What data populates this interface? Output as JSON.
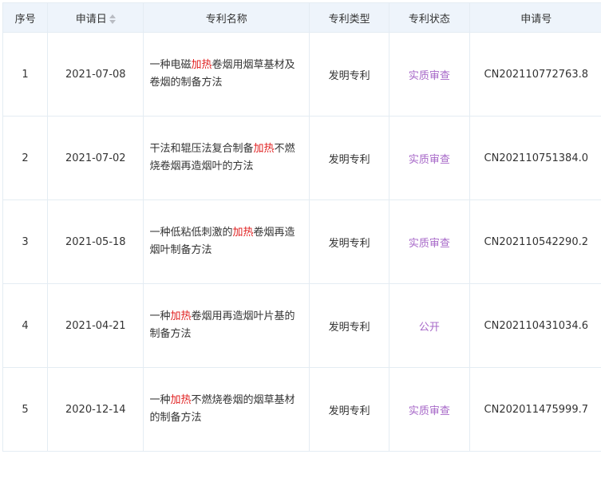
{
  "header": {
    "index": "序号",
    "date": "申请日",
    "name": "专利名称",
    "type": "专利类型",
    "status": "专利状态",
    "app_no": "申请号",
    "sort_icon": "sort-icon"
  },
  "rows": [
    {
      "index": "1",
      "date": "2021-07-08",
      "name_before": "一种电磁",
      "name_hl": "加热",
      "name_after": "卷烟用烟草基材及卷烟的制备方法",
      "type": "发明专利",
      "status": "实质审查",
      "app_no": "CN202110772763.8"
    },
    {
      "index": "2",
      "date": "2021-07-02",
      "name_before": "干法和辊压法复合制备",
      "name_hl": "加热",
      "name_after": "不燃烧卷烟再造烟叶的方法",
      "type": "发明专利",
      "status": "实质审查",
      "app_no": "CN202110751384.0"
    },
    {
      "index": "3",
      "date": "2021-05-18",
      "name_before": "一种低粘低刺激的",
      "name_hl": "加热",
      "name_after": "卷烟再造烟叶制备方法",
      "type": "发明专利",
      "status": "实质审查",
      "app_no": "CN202110542290.2"
    },
    {
      "index": "4",
      "date": "2021-04-21",
      "name_before": "一种",
      "name_hl": "加热",
      "name_after": "卷烟用再造烟叶片基的制备方法",
      "type": "发明专利",
      "status": "公开",
      "app_no": "CN202110431034.6"
    },
    {
      "index": "5",
      "date": "2020-12-14",
      "name_before": "一种",
      "name_hl": "加热",
      "name_after": "不燃烧卷烟的烟草基材的制备方法",
      "type": "发明专利",
      "status": "实质审查",
      "app_no": "CN202011475999.7"
    }
  ],
  "colors": {
    "header_bg": "#eef4fb",
    "border": "#e4ecf3",
    "highlight": "#e02020",
    "status": "#a768c8"
  }
}
